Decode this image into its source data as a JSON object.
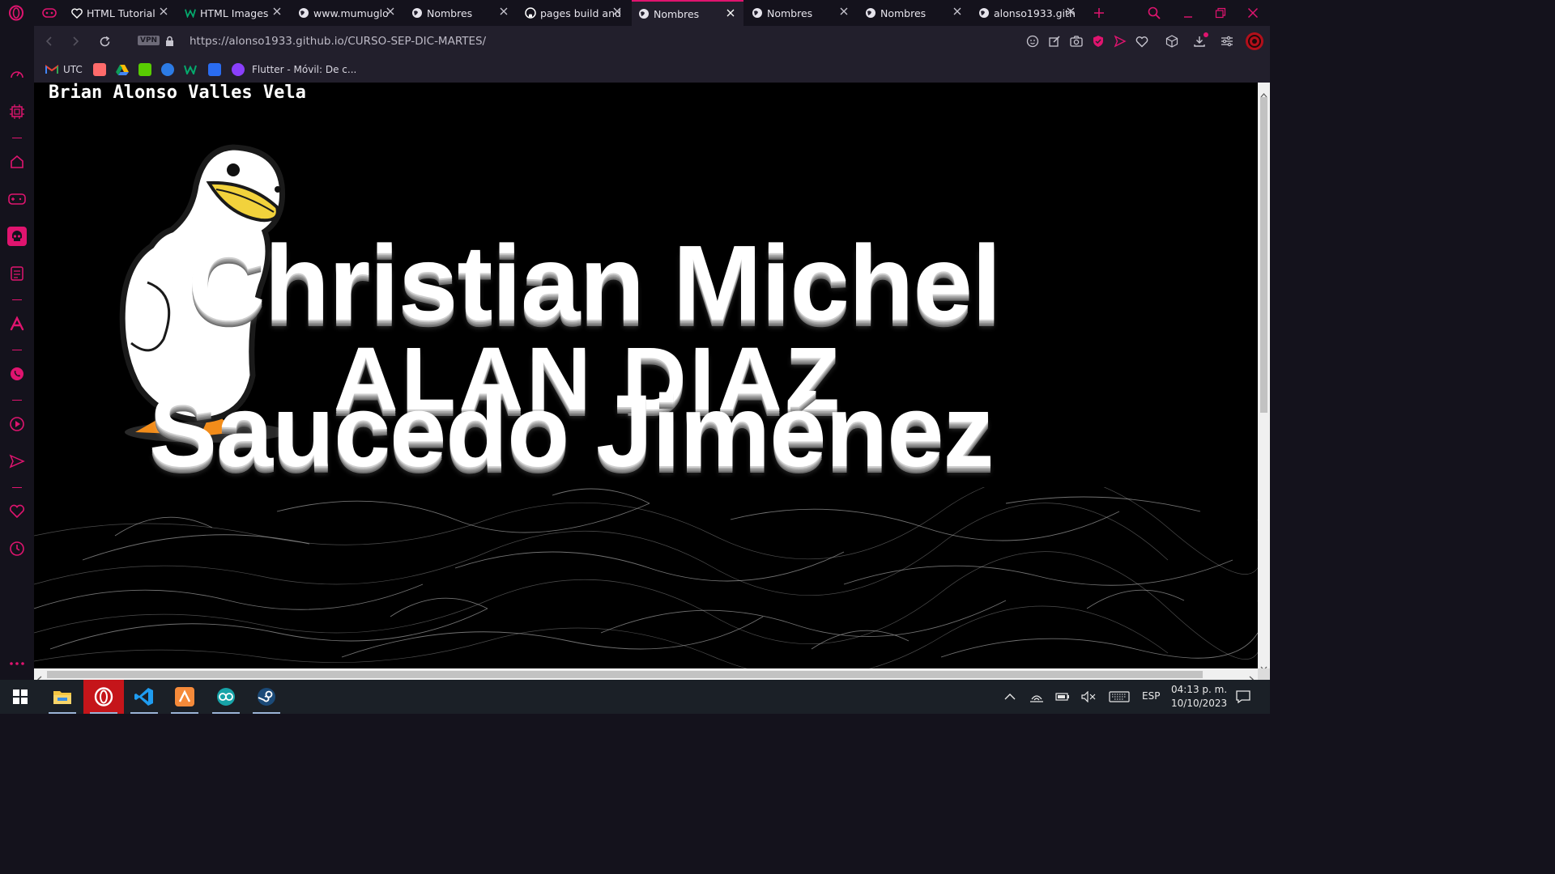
{
  "tabs": [
    {
      "title": "HTML Tutorial",
      "icon": "heart-icon",
      "active": false
    },
    {
      "title": "HTML Images",
      "icon": "w3schools-icon",
      "active": false
    },
    {
      "title": "www.mumuglo",
      "icon": "globe-icon",
      "active": false
    },
    {
      "title": "Nombres",
      "icon": "globe-icon",
      "active": false
    },
    {
      "title": "pages build and",
      "icon": "github-icon",
      "active": false
    },
    {
      "title": "Nombres",
      "icon": "globe-icon",
      "active": true
    },
    {
      "title": "Nombres",
      "icon": "globe-icon",
      "active": false
    },
    {
      "title": "Nombres",
      "icon": "globe-icon",
      "active": false
    },
    {
      "title": "alonso1933.gith",
      "icon": "globe-icon",
      "active": false
    }
  ],
  "address": {
    "vpn_label": "VPN",
    "url": "https://alonso1933.github.io/CURSO-SEP-DIC-MARTES/"
  },
  "bookmarks": [
    {
      "label": "UTC",
      "icon": "gmail-icon"
    },
    {
      "label": "",
      "icon": "books-icon"
    },
    {
      "label": "",
      "icon": "drive-icon"
    },
    {
      "label": "",
      "icon": "duolingo-icon"
    },
    {
      "label": "",
      "icon": "blue-icon"
    },
    {
      "label": "",
      "icon": "w-icon"
    },
    {
      "label": "",
      "icon": "p-icon"
    },
    {
      "label": "Flutter - Móvil: De c...",
      "icon": "flutter-icon"
    }
  ],
  "page": {
    "author": "Brian Alonso Valles Vela",
    "line1": "Christian Michel",
    "line2": "ALAN DIAZ",
    "line3": "Saucedo Jiménez"
  },
  "taskbar": {
    "language": "ESP",
    "time": "04:13 p. m.",
    "date": "10/10/2023"
  },
  "colors": {
    "accent": "#e0146f",
    "page_background": "#000000",
    "taskbar": "#1b2027",
    "opera_active": "#c5151a"
  }
}
